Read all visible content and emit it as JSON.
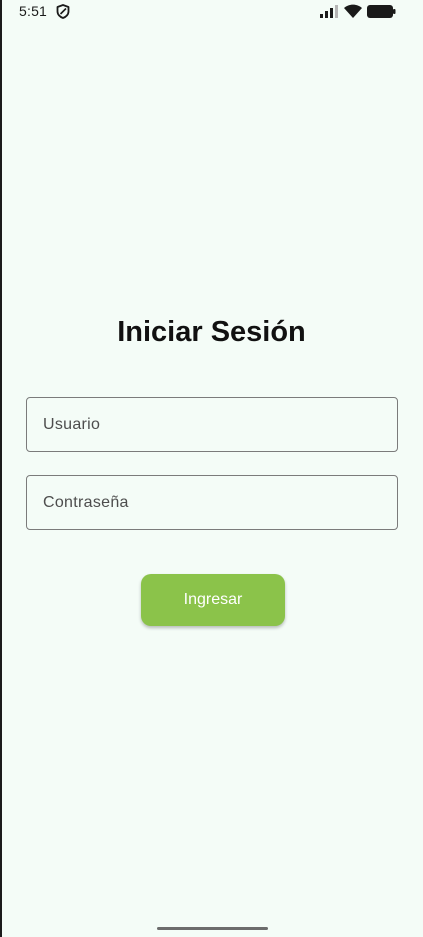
{
  "status_bar": {
    "time": "5:51",
    "icons": [
      "shield-icon",
      "signal-icon",
      "wifi-icon",
      "battery-icon"
    ]
  },
  "login": {
    "title": "Iniciar Sesión",
    "username_placeholder": "Usuario",
    "password_placeholder": "Contraseña",
    "submit_label": "Ingresar"
  },
  "colors": {
    "background": "#f4fcf7",
    "accent": "#8bc34a",
    "field_border": "#7b7b7b"
  }
}
